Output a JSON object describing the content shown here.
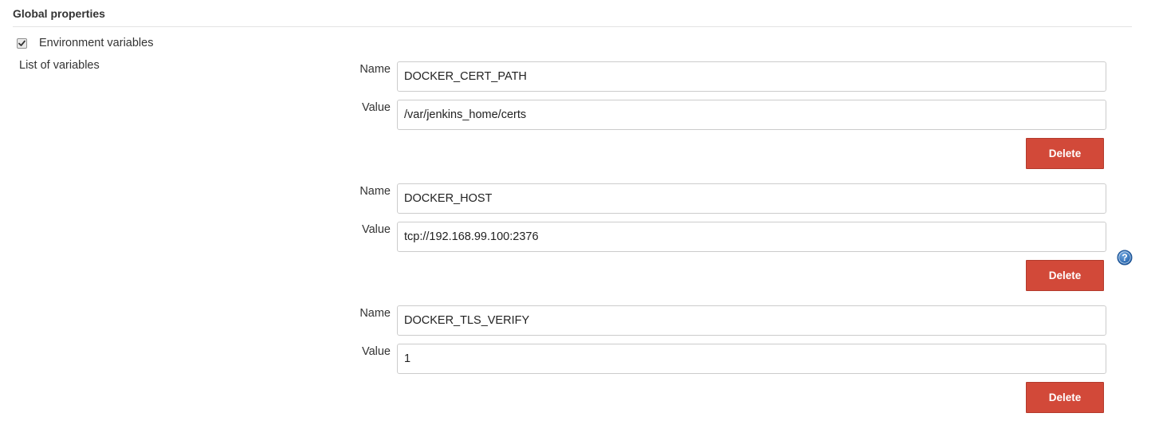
{
  "section": {
    "title": "Global properties"
  },
  "env_checkbox": {
    "label": "Environment variables",
    "checked": true
  },
  "list": {
    "label": "List of variables"
  },
  "variables": [
    {
      "name_label": "Name",
      "name_value": "DOCKER_CERT_PATH",
      "value_label": "Value",
      "value_value": "/var/jenkins_home/certs",
      "delete_label": "Delete"
    },
    {
      "name_label": "Name",
      "name_value": "DOCKER_HOST",
      "value_label": "Value",
      "value_value": "tcp://192.168.99.100:2376",
      "delete_label": "Delete"
    },
    {
      "name_label": "Name",
      "name_value": "DOCKER_TLS_VERIFY",
      "value_label": "Value",
      "value_value": "1",
      "delete_label": "Delete"
    }
  ],
  "colors": {
    "delete_button": "#d24939",
    "help_icon": "#2a6db5"
  },
  "icons": {
    "checkbox": "checkmark-icon",
    "help": "help-question-icon"
  }
}
